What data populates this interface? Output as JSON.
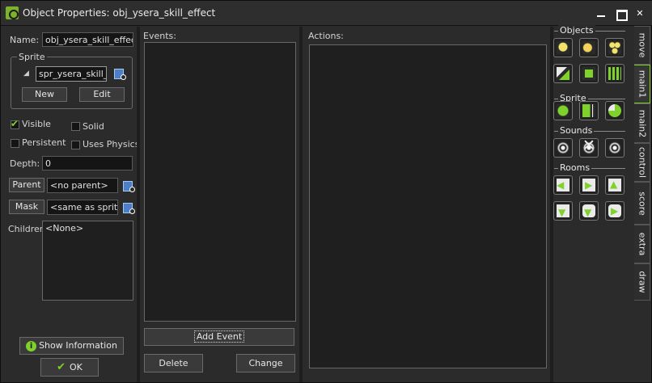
{
  "window": {
    "title": "Object Properties: obj_ysera_skill_effect"
  },
  "properties": {
    "name_label": "Name:",
    "name_value": "obj_ysera_skill_effect",
    "sprite_group_label": "Sprite",
    "sprite_value": "spr_ysera_skill_eff",
    "new_label": "New",
    "edit_label": "Edit",
    "visible_label": "Visible",
    "visible_checked": true,
    "solid_label": "Solid",
    "solid_checked": false,
    "persistent_label": "Persistent",
    "persistent_checked": false,
    "uses_physics_label": "Uses Physics",
    "uses_physics_checked": false,
    "depth_label": "Depth:",
    "depth_value": "0",
    "parent_label": "Parent",
    "parent_value": "<no parent>",
    "mask_label": "Mask",
    "mask_value": "<same as sprite>",
    "children_label": "Children:",
    "children_items": [
      "<None>"
    ],
    "show_info_label": "Show Information",
    "ok_label": "OK"
  },
  "events": {
    "label": "Events:",
    "add_event_label": "Add Event",
    "delete_label": "Delete",
    "change_label": "Change"
  },
  "actions": {
    "label": "Actions:"
  },
  "library": {
    "groups": [
      {
        "label": "Objects",
        "icons": [
          "create-instance-icon",
          "create-moving-icon",
          "create-random-icon",
          "change-instance-icon",
          "destroy-instance-icon",
          "destroy-at-position-icon"
        ]
      },
      {
        "label": "Sprite",
        "icons": [
          "change-sprite-icon",
          "transform-sprite-icon",
          "color-sprite-icon"
        ]
      },
      {
        "label": "Sounds",
        "icons": [
          "play-sound-icon",
          "stop-sound-icon",
          "check-sound-icon"
        ]
      },
      {
        "label": "Rooms",
        "icons": [
          "previous-room-icon",
          "next-room-icon",
          "restart-room-icon",
          "different-room-icon",
          "check-previous-icon",
          "check-next-icon"
        ]
      }
    ],
    "tabs": [
      "move",
      "main1",
      "main2",
      "control",
      "score",
      "extra",
      "draw"
    ],
    "active_tab": "main1",
    "accent_color": "#7fd12b"
  }
}
